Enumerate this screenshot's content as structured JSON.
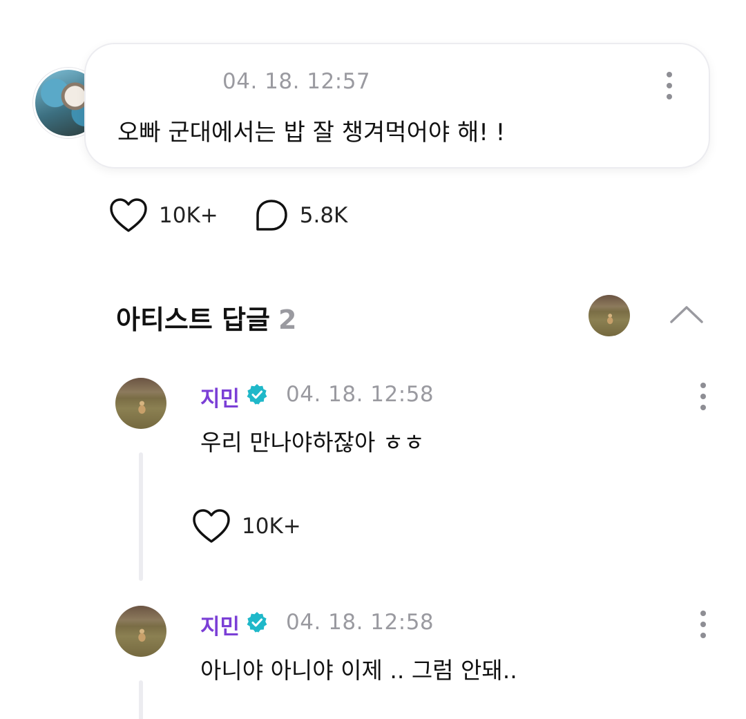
{
  "fan_comment": {
    "timestamp": "04. 18. 12:57",
    "text": "오빠 군대에서는 밥 잘 챙겨먹어야 해! !",
    "likes": "10K+",
    "replies": "5.8K"
  },
  "artist_replies": {
    "title": "아티스트 답글",
    "count": "2"
  },
  "replies": [
    {
      "author": "지민",
      "timestamp": "04. 18. 12:58",
      "text": "우리 만나야하잖아 ㅎㅎ",
      "likes": "10K+"
    },
    {
      "author": "지민",
      "timestamp": "04. 18. 12:58",
      "text": "아니야 아니야 이제 .. 그럼 안돼.."
    }
  ],
  "colors": {
    "artist_name": "#7b3fd6",
    "verified_badge": "#1fb8c9",
    "muted_text": "#9a9aa0"
  },
  "icons": {
    "like": "heart-outline-icon",
    "comment": "speech-bubble-icon",
    "more": "more-vertical-icon",
    "collapse": "chevron-up-icon",
    "verified": "verified-badge-icon"
  }
}
